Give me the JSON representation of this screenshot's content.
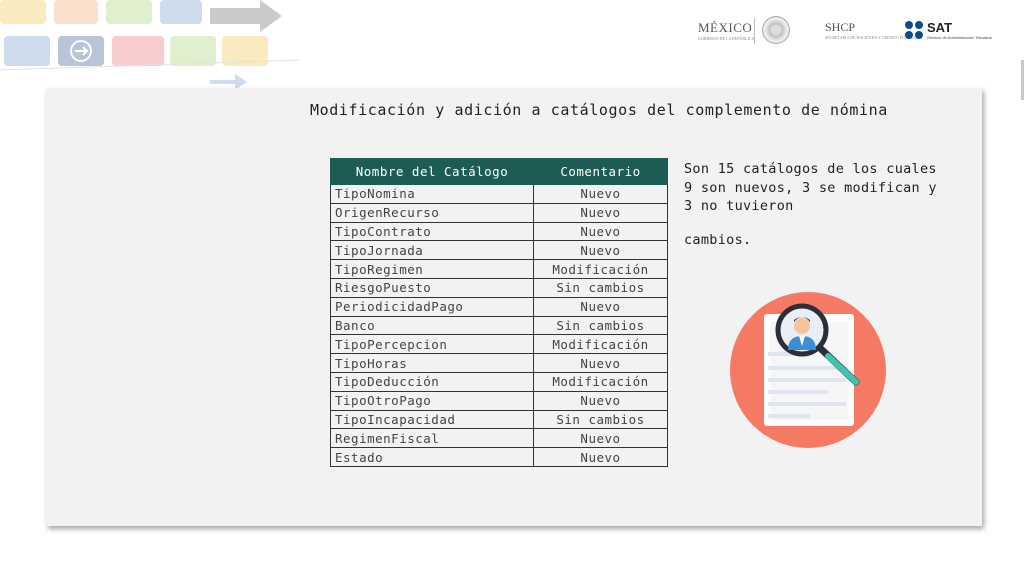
{
  "header": {
    "logo_mexico": "MÉXICO",
    "logo_mexico_sub": "GOBIERNO DE LA REPÚBLICA",
    "logo_shcp": "SHCP",
    "logo_shcp_sub": "SECRETARÍA DE HACIENDA Y CRÉDITO PÚBLICO",
    "logo_sat": "SAT",
    "logo_sat_sub": "Servicio de Administración Tributaria"
  },
  "slide": {
    "title": "Modificación y adición a catálogos del complemento de nómina",
    "table": {
      "headers": [
        "Nombre del Catálogo",
        "Comentario"
      ],
      "rows": [
        [
          "TipoNomina",
          "Nuevo"
        ],
        [
          "OrigenRecurso",
          "Nuevo"
        ],
        [
          "TipoContrato",
          "Nuevo"
        ],
        [
          "TipoJornada",
          "Nuevo"
        ],
        [
          "TipoRegimen",
          "Modificación"
        ],
        [
          "RiesgoPuesto",
          "Sin cambios"
        ],
        [
          "PeriodicidadPago",
          "Nuevo"
        ],
        [
          "Banco",
          "Sin cambios"
        ],
        [
          "TipoPercepcion",
          "Modificación"
        ],
        [
          "TipoHoras",
          "Nuevo"
        ],
        [
          "TipoDeducción",
          "Modificación"
        ],
        [
          "TipoOtroPago",
          "Nuevo"
        ],
        [
          "TipoIncapacidad",
          "Sin cambios"
        ],
        [
          "RegimenFiscal",
          "Nuevo"
        ],
        [
          "Estado",
          "Nuevo"
        ]
      ]
    },
    "summary_line1": "Son 15 catálogos de los cuales 9 son nuevos,  3 se modifican  y 3 no tuvieron",
    "summary_line2": "cambios.",
    "illustration_icon": "document-magnifier-icon"
  },
  "colors": {
    "table_header": "#1d5c54",
    "illustration_circle": "#f47a63",
    "panel": "#f2f2f2"
  }
}
